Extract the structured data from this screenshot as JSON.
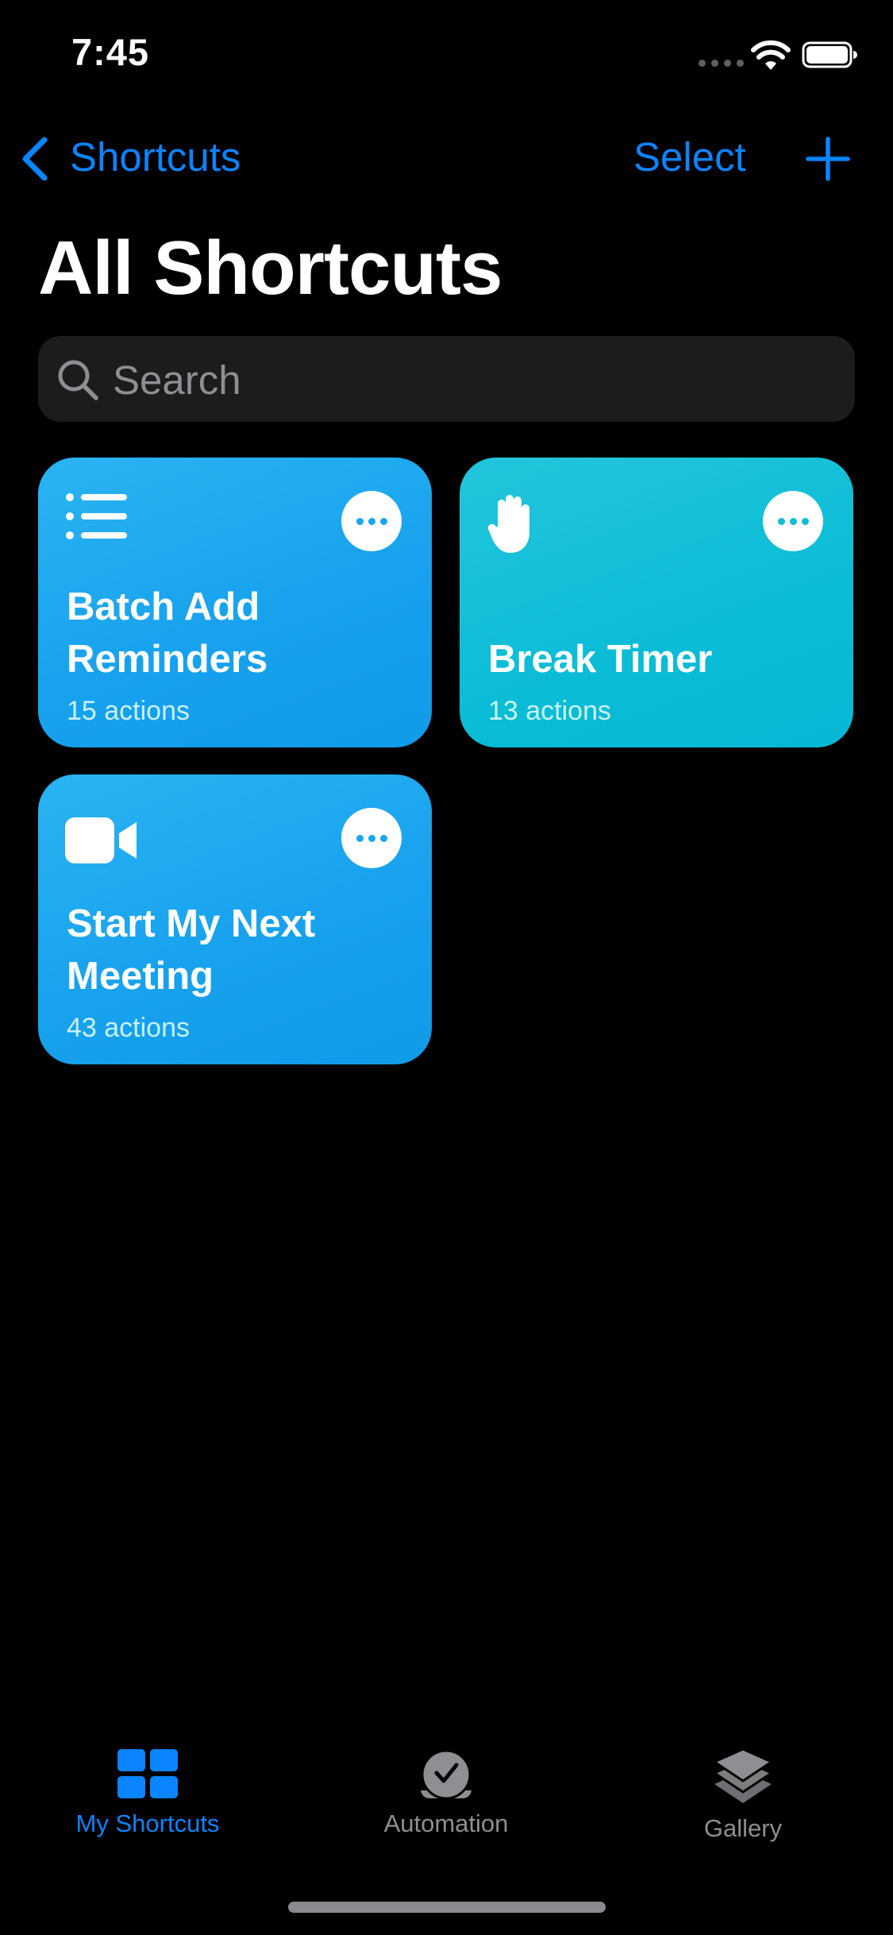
{
  "status_bar": {
    "time": "7:45"
  },
  "nav": {
    "back_label": "Shortcuts",
    "select_label": "Select",
    "add_icon": "plus-icon"
  },
  "page": {
    "title": "All Shortcuts"
  },
  "search": {
    "placeholder": "Search",
    "value": ""
  },
  "shortcuts": [
    {
      "title": "Batch Add Reminders",
      "subtitle": "15 actions",
      "icon": "list-icon",
      "color": "#1aa6ef"
    },
    {
      "title": "Break Timer",
      "subtitle": "13 actions",
      "icon": "hand-icon",
      "color": "#0fbfd7"
    },
    {
      "title": "Start My Next Meeting",
      "subtitle": "43 actions",
      "icon": "video-camera-icon",
      "color": "#1aa6ef"
    }
  ],
  "tabs": [
    {
      "label": "My Shortcuts",
      "icon": "grid-icon",
      "active": true
    },
    {
      "label": "Automation",
      "icon": "checkmark-clock-icon",
      "active": false
    },
    {
      "label": "Gallery",
      "icon": "layers-icon",
      "active": false
    }
  ],
  "colors": {
    "accent": "#0a84ff",
    "inactive_tab": "#8e8e93",
    "background": "#000000"
  }
}
